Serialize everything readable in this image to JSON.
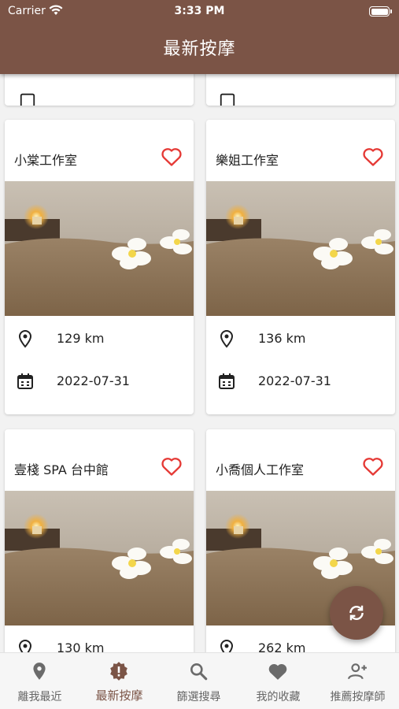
{
  "status_bar": {
    "carrier": "Carrier",
    "time": "3:33 PM"
  },
  "header": {
    "title": "最新按摩"
  },
  "cards": [
    {
      "name": "小棠工作室",
      "distance": "129 km",
      "date": "2022-07-31"
    },
    {
      "name": "樂姐工作室",
      "distance": "136 km",
      "date": "2022-07-31"
    },
    {
      "name": "壹棧 SPA 台中館",
      "distance": "130 km",
      "date": ""
    },
    {
      "name": "小喬個人工作室",
      "distance": "262 km",
      "date": ""
    }
  ],
  "icons": {
    "favorite": "heart-outline-icon",
    "distance": "location-pin-icon",
    "date": "calendar-icon",
    "refresh": "refresh-icon"
  },
  "bottom_nav": [
    {
      "label": "離我最近",
      "icon": "location-pin-icon"
    },
    {
      "label": "最新按摩",
      "icon": "alert-badge-icon",
      "active": true
    },
    {
      "label": "篩選搜尋",
      "icon": "search-icon"
    },
    {
      "label": "我的收藏",
      "icon": "heart-icon"
    },
    {
      "label": "推薦按摩師",
      "icon": "add-person-icon"
    }
  ],
  "colors": {
    "primary": "#7b5446",
    "heart": "#e53935",
    "inactive_nav": "#666666"
  }
}
